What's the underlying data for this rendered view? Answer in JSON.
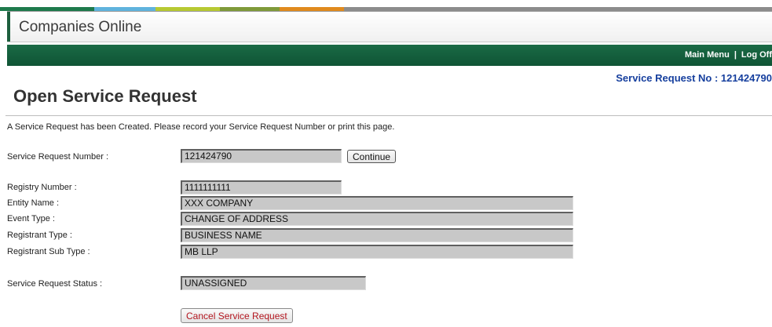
{
  "colors": {
    "strip": [
      "#1e7a4c",
      "#5fb3dd",
      "#b7c933",
      "#7f9a3a",
      "#e08a1e",
      "#8c8c8c"
    ],
    "nav_bg": "#14603d",
    "link_blue": "#163f9e",
    "cancel_red": "#b3161f"
  },
  "app": {
    "title": "Companies Online"
  },
  "nav": {
    "main_menu": "Main Menu",
    "separator": "|",
    "log_off": "Log Off"
  },
  "header": {
    "sr_no": "Service Request No : 121424790"
  },
  "page": {
    "heading": "Open Service Request",
    "notice": "A Service Request has been Created. Please record your Service Request Number or print this page."
  },
  "form": {
    "sr_number": {
      "label": "Service Request Number :",
      "value": "121424790"
    },
    "continue_label": "Continue",
    "registry_number": {
      "label": "Registry Number :",
      "value": "1111111111"
    },
    "entity_name": {
      "label": "Entity Name :",
      "value": "XXX COMPANY"
    },
    "event_type": {
      "label": "Event Type :",
      "value": "CHANGE OF ADDRESS"
    },
    "registrant_type": {
      "label": "Registrant Type :",
      "value": "BUSINESS NAME"
    },
    "registrant_sub_type": {
      "label": "Registrant Sub Type :",
      "value": "MB LLP"
    },
    "status": {
      "label": "Service Request Status :",
      "value": "UNASSIGNED"
    },
    "cancel_label": "Cancel Service Request"
  }
}
